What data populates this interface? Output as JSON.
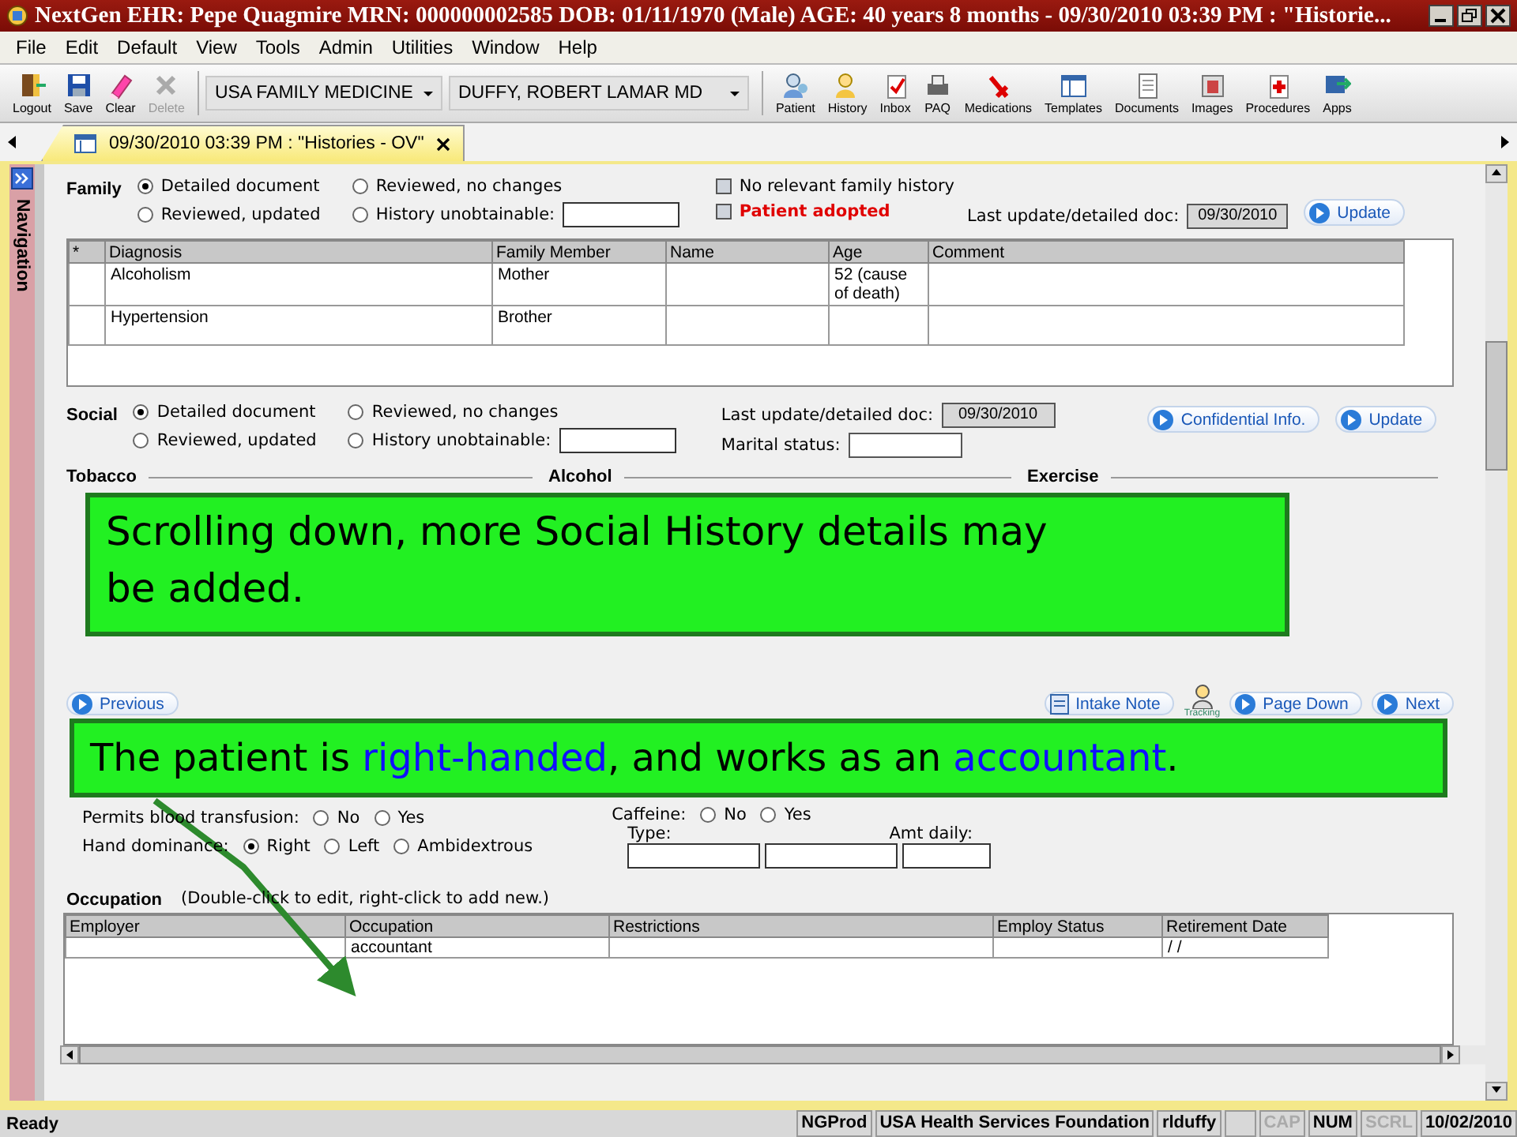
{
  "window": {
    "title": "NextGen EHR: Pepe Quagmire  MRN: 000000002585  DOB: 01/11/1970  (Male)  AGE: 40 years 8 months - 09/30/2010 03:39 PM : \"Historie..."
  },
  "menu": [
    "File",
    "Edit",
    "Default",
    "View",
    "Tools",
    "Admin",
    "Utilities",
    "Window",
    "Help"
  ],
  "toolbar": {
    "left": [
      {
        "label": "Logout",
        "disabled": false
      },
      {
        "label": "Save",
        "disabled": false
      },
      {
        "label": "Clear",
        "disabled": false
      },
      {
        "label": "Delete",
        "disabled": true
      }
    ],
    "practice": "USA FAMILY MEDICINE",
    "provider": "DUFFY, ROBERT  LAMAR MD",
    "right": [
      {
        "label": "Patient"
      },
      {
        "label": "History"
      },
      {
        "label": "Inbox"
      },
      {
        "label": "PAQ"
      },
      {
        "label": "Medications"
      },
      {
        "label": "Templates"
      },
      {
        "label": "Documents"
      },
      {
        "label": "Images"
      },
      {
        "label": "Procedures"
      },
      {
        "label": "Apps"
      }
    ]
  },
  "tab": {
    "label": "09/30/2010 03:39 PM : \"Histories - OV\"",
    "selected": true
  },
  "navigation": {
    "label": "Navigation"
  },
  "family": {
    "label": "Family",
    "options": [
      {
        "label": "Detailed document",
        "selected": true
      },
      {
        "label": "Reviewed, no changes",
        "selected": false
      },
      {
        "label": "Reviewed, updated",
        "selected": false
      },
      {
        "label": "History unobtainable:",
        "selected": false
      }
    ],
    "checks": [
      {
        "label": "No relevant family history",
        "checked": false
      },
      {
        "label": "Patient adopted",
        "checked": false
      }
    ],
    "last_update_label": "Last update/detailed doc:",
    "last_update": "09/30/2010",
    "update_button": "Update",
    "table": {
      "columns": [
        "*",
        "Diagnosis",
        "Family Member",
        "Name",
        "Age",
        "Comment"
      ],
      "rows": [
        {
          "diagnosis": "Alcoholism",
          "family_member": "Mother",
          "age": "52 (cause of death)"
        },
        {
          "diagnosis": "Hypertension",
          "family_member": "Brother"
        }
      ]
    }
  },
  "social": {
    "label": "Social",
    "options": [
      {
        "label": "Detailed document",
        "selected": true
      },
      {
        "label": "Reviewed, no changes",
        "selected": false
      },
      {
        "label": "Reviewed, updated",
        "selected": false
      },
      {
        "label": "History unobtainable:",
        "selected": false
      }
    ],
    "last_update_label": "Last update/detailed doc:",
    "last_update": "09/30/2010",
    "marital_status_label": "Marital status:",
    "confidential_button": "Confidential Info.",
    "update_button": "Update",
    "headings": [
      "Tobacco",
      "Alcohol",
      "Exercise"
    ]
  },
  "nav_buttons": {
    "previous": "Previous",
    "intake_note": "Intake Note",
    "tracking": "Tracking",
    "page_down": "Page Down",
    "next": "Next"
  },
  "social_continued": {
    "transfusion": {
      "label": "Permits blood transfusion:",
      "options": [
        {
          "label": "No",
          "selected": false
        },
        {
          "label": "Yes",
          "selected": false
        }
      ]
    },
    "hand": {
      "label": "Hand dominance:",
      "options": [
        {
          "label": "Right",
          "selected": true
        },
        {
          "label": "Left",
          "selected": false
        },
        {
          "label": "Ambidextrous",
          "selected": false
        }
      ]
    },
    "caffeine": {
      "label": "Caffeine:",
      "options": [
        {
          "label": "No",
          "selected": false
        },
        {
          "label": "Yes",
          "selected": false
        }
      ]
    },
    "type_label": "Type:",
    "amount_label": "Amt daily:"
  },
  "occupation": {
    "label": "Occupation",
    "hint": "(Double-click to edit, right-click to add new.)",
    "columns": [
      "Employer",
      "Occupation",
      "Restrictions",
      "Employ Status",
      "Retirement Date"
    ],
    "rows": [
      {
        "occupation": "accountant",
        "retirement_date": "/ /"
      }
    ]
  },
  "callouts": [
    {
      "parts": [
        {
          "text": "Scrolling down, more Social History details may be added.",
          "highlight": false
        }
      ]
    },
    {
      "parts": [
        {
          "text": "The patient is ",
          "highlight": false
        },
        {
          "text": "right-handed",
          "highlight": true
        },
        {
          "text": ", and works as an ",
          "highlight": false
        },
        {
          "text": "accountant",
          "highlight": true
        },
        {
          "text": ".",
          "highlight": false
        }
      ]
    }
  ],
  "status_bar": {
    "message": "Ready",
    "panels": [
      {
        "text": "NGProd",
        "disabled": false
      },
      {
        "text": "USA Health Services Foundation",
        "disabled": false
      },
      {
        "text": "rlduffy",
        "disabled": false
      },
      {
        "text": "CAP",
        "disabled": true
      },
      {
        "text": "NUM",
        "disabled": false
      },
      {
        "text": "SCRL",
        "disabled": true
      },
      {
        "text": "10/02/2010",
        "disabled": false
      }
    ]
  }
}
